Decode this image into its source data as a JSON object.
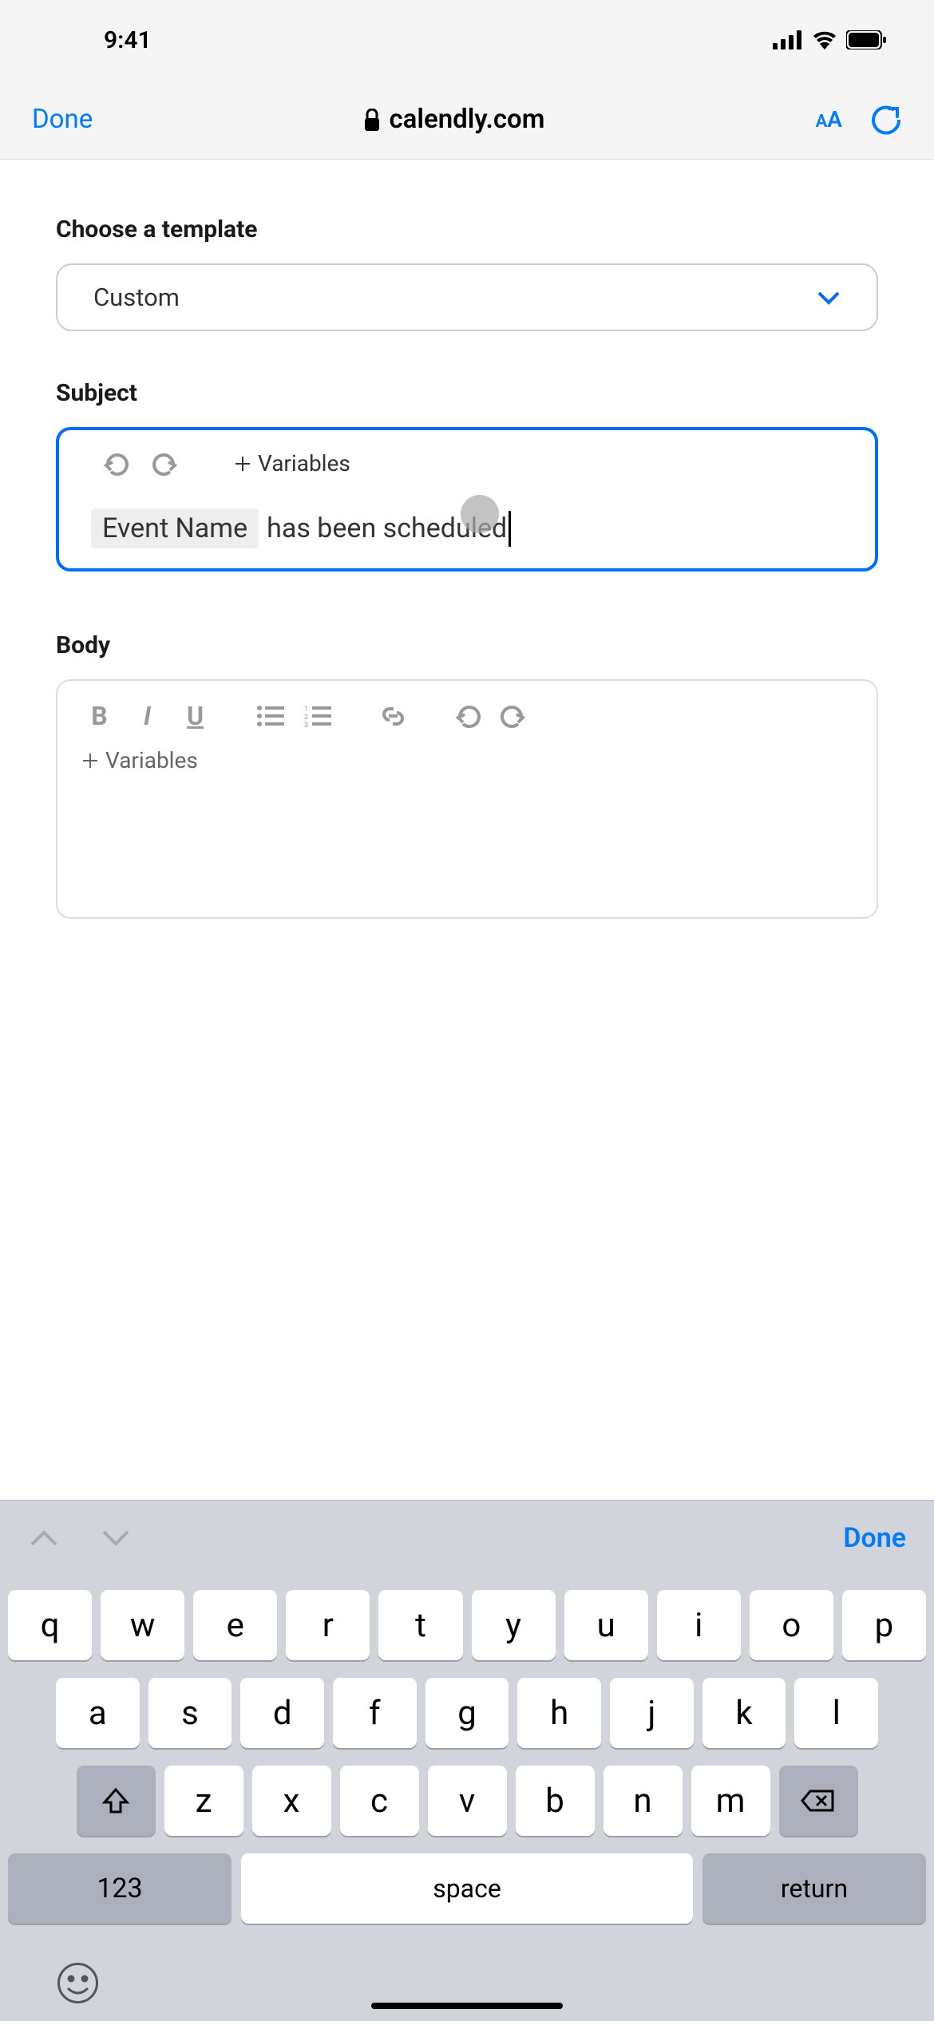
{
  "status": {
    "time": "9:41"
  },
  "browser": {
    "done_label": "Done",
    "url": "calendly.com",
    "text_size": "AA"
  },
  "form": {
    "template_label": "Choose a template",
    "template_value": "Custom",
    "subject_label": "Subject",
    "variables_label": "Variables",
    "subject_variable": "Event Name",
    "subject_text": " has been scheduled",
    "body_label": "Body",
    "body_variables_label": "Variables"
  },
  "keyboard_nav": {
    "done": "Done"
  },
  "keyboard": {
    "row1": [
      "q",
      "w",
      "e",
      "r",
      "t",
      "y",
      "u",
      "i",
      "o",
      "p"
    ],
    "row2": [
      "a",
      "s",
      "d",
      "f",
      "g",
      "h",
      "j",
      "k",
      "l"
    ],
    "row3": [
      "z",
      "x",
      "c",
      "v",
      "b",
      "n",
      "m"
    ],
    "numbers": "123",
    "space": "space",
    "return": "return"
  }
}
